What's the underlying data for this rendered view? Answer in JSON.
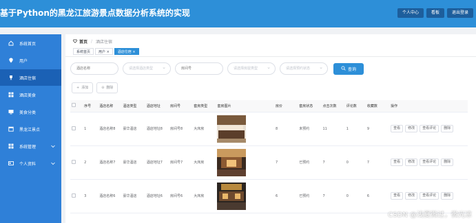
{
  "header": {
    "title": "基于Python的黑龙江旅游景点数据分析系统的实现",
    "buttons": [
      "个人中心",
      "看板",
      "退出登录"
    ]
  },
  "sidebar": {
    "items": [
      {
        "label": "系统首页",
        "icon": "home-icon"
      },
      {
        "label": "用户",
        "icon": "location-pin-icon"
      },
      {
        "label": "酒店住宿",
        "icon": "trophy-icon",
        "active": true
      },
      {
        "label": "酒店美食",
        "icon": "grid-icon"
      },
      {
        "label": "美食分类",
        "icon": "monitor-icon"
      },
      {
        "label": "黑龙江景点",
        "icon": "calendar-icon"
      },
      {
        "label": "系统管理",
        "icon": "grid-icon",
        "has_submenu": true
      },
      {
        "label": "个人资料",
        "icon": "id-card-icon",
        "has_submenu": true
      }
    ]
  },
  "breadcrumb": {
    "home": "首页",
    "current": "酒店住宿"
  },
  "tabs": [
    {
      "label": "系统首页"
    },
    {
      "label": "用户 ×"
    },
    {
      "label": "酒店住宿 ×",
      "active": true
    }
  ],
  "search": {
    "hotel_name_placeholder": "酒店名称",
    "hotel_type_placeholder": "请选择酒店类型",
    "room_no_placeholder": "房间号",
    "room_type_placeholder": "请选择房屋类型",
    "status_placeholder": "请选择预约状态",
    "query_label": "查询"
  },
  "actions": {
    "add_label": "添加",
    "delete_label": "删除"
  },
  "table": {
    "columns": [
      "",
      "序号",
      "酒店名称",
      "酒店类型",
      "酒店地址",
      "房间号",
      "套房类型",
      "套房图片",
      "房价",
      "套房状态",
      "点击次数",
      "评论数",
      "收藏数",
      "操作"
    ],
    "rows": [
      {
        "index": "1",
        "name": "酒店名称8",
        "type": "豪华酒店",
        "address": "酒店地址8",
        "room_no": "房间号8",
        "room_type": "大床房",
        "price": "8",
        "status": "未预约",
        "clicks": "11",
        "comments": "1",
        "favorites": "9"
      },
      {
        "index": "2",
        "name": "酒店名称7",
        "type": "豪华酒店",
        "address": "酒店地址7",
        "room_no": "房间号7",
        "room_type": "大床房",
        "price": "7",
        "status": "已预约",
        "clicks": "7",
        "comments": "0",
        "favorites": "7"
      },
      {
        "index": "3",
        "name": "酒店名称6",
        "type": "豪华酒店",
        "address": "酒店地址6",
        "room_no": "房间号6",
        "room_type": "大床房",
        "price": "6",
        "status": "已预约",
        "clicks": "7",
        "comments": "0",
        "favorites": "6"
      }
    ],
    "row_ops": [
      "查看",
      "修改",
      "查看评论",
      "删除"
    ]
  },
  "watermark": "CSDN @浅夏微过，微光凉",
  "colors": {
    "header_bg": "#2d8fd8",
    "sidebar_bg": "#2f80d8",
    "sidebar_active": "#1b61b5",
    "primary": "#2d8fd8"
  }
}
